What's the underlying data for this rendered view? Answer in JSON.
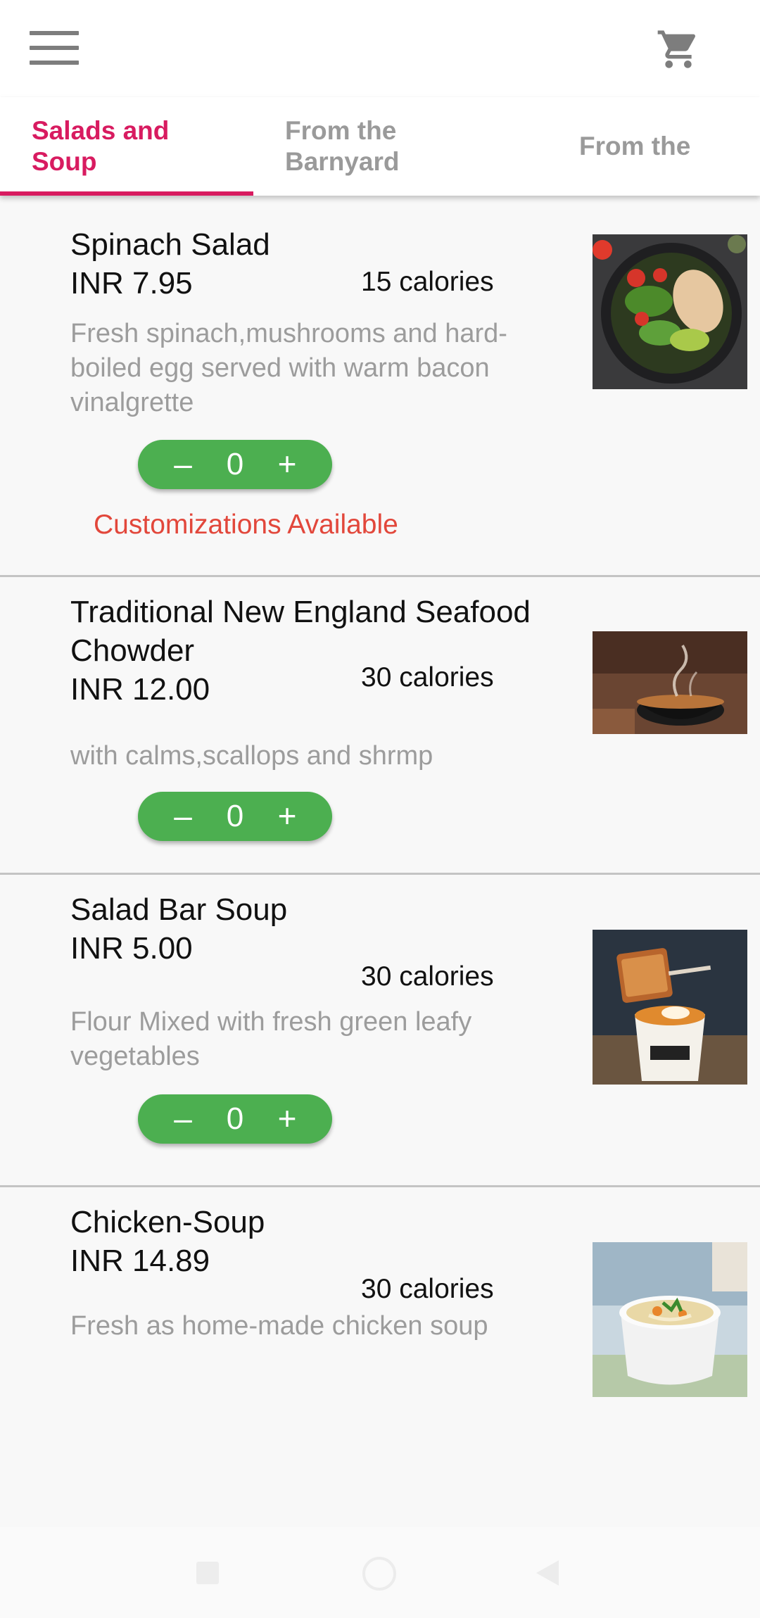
{
  "header": {
    "menu_icon": "hamburger-menu-icon",
    "cart_icon": "shopping-cart-icon"
  },
  "tabs": [
    {
      "label": "Salads and Soup",
      "active": true
    },
    {
      "label": "From the Barnyard",
      "active": false
    },
    {
      "label": "From the",
      "active": false
    }
  ],
  "colors": {
    "accent": "#d81b60",
    "stepper": "#4caf50",
    "customizations": "#e2473b"
  },
  "items": [
    {
      "name": "Spinach Salad",
      "price": "INR 7.95",
      "calories": "15 calories",
      "description": "Fresh spinach,mushrooms and hard-boiled egg served with warm bacon vinalgrette",
      "quantity": "0",
      "customizations": "Customizations Available"
    },
    {
      "name": "Traditional New England Seafood Chowder",
      "price": "INR 12.00",
      "calories": "30 calories",
      "description": "with calms,scallops and shrmp",
      "quantity": "0"
    },
    {
      "name": "Salad Bar Soup",
      "price": "INR 5.00",
      "calories": "30 calories",
      "description": "Flour Mixed with fresh green leafy vegetables",
      "quantity": "0"
    },
    {
      "name": "Chicken-Soup",
      "price": "INR 14.89",
      "calories": "30 calories",
      "description": "Fresh as home-made chicken soup"
    }
  ],
  "stepper": {
    "minus": "–",
    "plus": "+"
  },
  "system_nav": {
    "recents_icon": "square-recents-icon",
    "home_icon": "circle-home-icon",
    "back_icon": "triangle-back-icon"
  }
}
